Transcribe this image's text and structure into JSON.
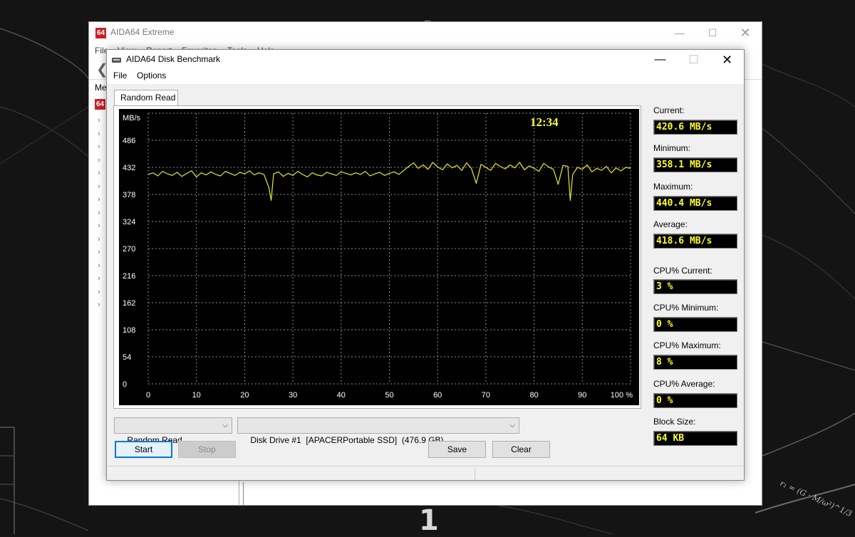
{
  "desktop": {
    "wallpaper_number": "1",
    "formula": "r₁ = (G · M/ω²)^1/3"
  },
  "main_window": {
    "logo": "64",
    "title": "AIDA64 Extreme",
    "menu": [
      "File",
      "View",
      "Report",
      "Favorites",
      "Tools",
      "Help"
    ],
    "menu_tab_label": "Me",
    "tree_logo": "64",
    "tree_arrow_count": 15
  },
  "bench_window": {
    "title": "AIDA64 Disk Benchmark",
    "menu": {
      "file": "File",
      "options": "Options"
    },
    "tab": "Random Read",
    "time": "12:34",
    "stats": {
      "current_label": "Current:",
      "current": "420.6 MB/s",
      "minimum_label": "Minimum:",
      "minimum": "358.1 MB/s",
      "maximum_label": "Maximum:",
      "maximum": "440.4 MB/s",
      "average_label": "Average:",
      "average": "418.6 MB/s",
      "cpu_current_label": "CPU% Current:",
      "cpu_current": "3 %",
      "cpu_minimum_label": "CPU% Minimum:",
      "cpu_minimum": "0 %",
      "cpu_maximum_label": "CPU% Maximum:",
      "cpu_maximum": "8 %",
      "cpu_average_label": "CPU% Average:",
      "cpu_average": "0 %",
      "block_size_label": "Block Size:",
      "block_size": "64 KB"
    },
    "controls": {
      "test_select": "Random Read",
      "drive_select": "Disk Drive #1  [APACERPortable SSD]  (476.9 GB)",
      "start": "Start",
      "stop": "Stop",
      "save": "Save",
      "clear": "Clear"
    }
  },
  "colors": {
    "plot_background": "#000000",
    "series": "#e8e830",
    "grid": "#8c8c8c",
    "readout_text": "#ffff22",
    "plot_time": "#ffff33"
  },
  "chart_data": {
    "type": "line",
    "ylabel": "MB/s",
    "y_ticks": [
      0,
      54,
      108,
      162,
      216,
      270,
      324,
      378,
      432,
      486
    ],
    "x_tick_labels": [
      "0",
      "10",
      "20",
      "30",
      "40",
      "50",
      "60",
      "70",
      "80",
      "90",
      "100 %"
    ],
    "ylim": [
      0,
      540
    ],
    "xlim": [
      0,
      100
    ],
    "grid": true,
    "series": [
      {
        "x": [
          0,
          1,
          2,
          3,
          4,
          5,
          6,
          7,
          8,
          9,
          10,
          11,
          12,
          13,
          14,
          15,
          16,
          17,
          18,
          19,
          20,
          21,
          22,
          23,
          24,
          25,
          25.5,
          26,
          27,
          28,
          29,
          30,
          31,
          32,
          33,
          34,
          35,
          36,
          37,
          38,
          39,
          40,
          41,
          42,
          43,
          44,
          45,
          46,
          47,
          48,
          49,
          50,
          51,
          52,
          53,
          54,
          55,
          56,
          57,
          58,
          59,
          60,
          61,
          62,
          63,
          64,
          65,
          66,
          67,
          68,
          69,
          70,
          71,
          72,
          73,
          74,
          75,
          76,
          77,
          78,
          79,
          80,
          81,
          82,
          83,
          84,
          85,
          86,
          87,
          87.5,
          88,
          89,
          90,
          91,
          92,
          93,
          94,
          95,
          96,
          97,
          98,
          99,
          100
        ],
        "values": [
          418,
          421,
          415,
          424,
          419,
          416,
          422,
          414,
          420,
          425,
          413,
          421,
          417,
          423,
          418,
          415,
          424,
          420,
          416,
          422,
          419,
          425,
          417,
          421,
          418,
          392,
          366,
          419,
          423,
          414,
          420,
          416,
          424,
          418,
          413,
          421,
          417,
          415,
          422,
          419,
          416,
          423,
          420,
          417,
          421,
          418,
          424,
          415,
          419,
          422,
          416,
          420,
          423,
          418,
          426,
          434,
          441,
          430,
          437,
          428,
          442,
          433,
          427,
          439,
          431,
          436,
          426,
          441,
          430,
          400,
          438,
          432,
          426,
          440,
          434,
          429,
          437,
          431,
          442,
          427,
          435,
          430,
          424,
          440,
          433,
          428,
          398,
          436,
          434,
          366,
          418,
          432,
          428,
          437,
          423,
          430,
          426,
          434,
          421,
          431,
          425,
          432,
          430
        ]
      }
    ]
  }
}
